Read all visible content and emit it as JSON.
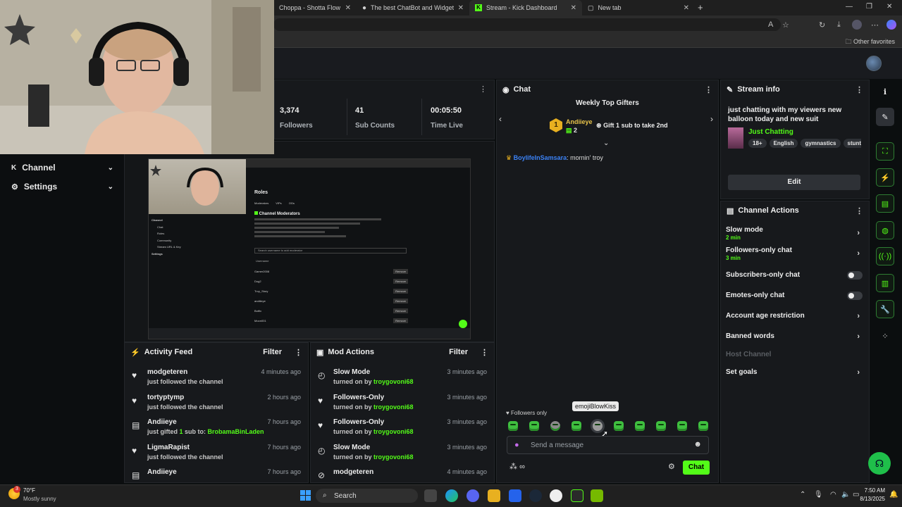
{
  "browser": {
    "tabs": [
      {
        "label": "Choppa - Shotta Flow Remix"
      },
      {
        "label": "The best ChatBot and Widgets fo"
      },
      {
        "label": "Stream - Kick Dashboard"
      },
      {
        "label": "New tab"
      }
    ],
    "other_favorites": "Other favorites"
  },
  "nav": {
    "items": [
      {
        "label": "Channel"
      },
      {
        "label": "Settings"
      }
    ]
  },
  "stats": {
    "followers_value": "3,374",
    "followers_label": "Followers",
    "subs_value": "41",
    "subs_label": "Sub Counts",
    "time_value": "00:05:50",
    "time_label": "Time Live"
  },
  "preview": {
    "roles_title": "Roles",
    "tabs": [
      "Moderators",
      "VIPs",
      "OGs"
    ],
    "section_title": "Channel Moderators",
    "search_placeholder": "Search username to add moderator",
    "column": "Username",
    "mods": [
      "Gamer2008",
      "Dog2",
      "Troy_Story",
      "andiiieye",
      "Botfix",
      "Moon001"
    ],
    "remove_label": "Remove",
    "menu": [
      "Channel",
      "Chat",
      "Roles",
      "Community",
      "Stream URL & Key",
      "Settings"
    ]
  },
  "activity_feed": {
    "title": "Activity Feed",
    "filter": "Filter",
    "items": [
      {
        "name": "modgeteren",
        "sub": "just followed the channel",
        "time": "4 minutes ago"
      },
      {
        "name": "tortyptymp",
        "sub": "just followed the channel",
        "time": "2 hours ago"
      },
      {
        "name": "Andiieye",
        "sub_prefix": "just gifted ",
        "sub_count": "1",
        "sub_mid": " sub to: ",
        "sub_target": "BrobamaBinLaden",
        "time": "7 hours ago"
      },
      {
        "name": "LigmaRapist",
        "sub": "just followed the channel",
        "time": "7 hours ago"
      },
      {
        "name": "Andiieye",
        "sub": "",
        "time": "7 hours ago"
      }
    ]
  },
  "mod_actions": {
    "title": "Mod Actions",
    "filter": "Filter",
    "items": [
      {
        "name": "Slow Mode",
        "sub_prefix": "turned on by ",
        "user": "troygovoni68",
        "time": "3 minutes ago"
      },
      {
        "name": "Followers-Only",
        "sub_prefix": "turned on by ",
        "user": "troygovoni68",
        "time": "3 minutes ago"
      },
      {
        "name": "Followers-Only",
        "sub_prefix": "turned on by ",
        "user": "troygovoni68",
        "time": "3 minutes ago"
      },
      {
        "name": "Slow Mode",
        "sub_prefix": "turned on by ",
        "user": "troygovoni68",
        "time": "3 minutes ago"
      },
      {
        "name": "modgeteren",
        "sub_prefix": "",
        "user": "",
        "time": "4 minutes ago"
      }
    ]
  },
  "chat": {
    "title": "Chat",
    "top_gifters_title": "Weekly Top Gifters",
    "gifter_rank": "1",
    "gifter_name": "Andiieye",
    "gifter_count": "2",
    "gift_cta": "Gift 1 sub to take 2nd",
    "messages": [
      {
        "user": "BoylifeInSamsara",
        "text": ": mornin' troy"
      }
    ],
    "followers_only_label": "Followers only",
    "emote_tooltip": "emojiBlowKiss",
    "input_placeholder": "Send a message",
    "infinity": "∞",
    "send_button": "Chat"
  },
  "stream_info": {
    "title": "Stream info",
    "stream_title": "just chatting with my viewers new balloon today and new suit",
    "category": "Just Chatting",
    "tags": [
      "18+",
      "English",
      "gymnastics",
      "stunt"
    ],
    "edit_button": "Edit"
  },
  "channel_actions": {
    "title": "Channel Actions",
    "rows": [
      {
        "label": "Slow mode",
        "sub": "2 min"
      },
      {
        "label": "Followers-only chat",
        "sub": "3 min"
      },
      {
        "label": "Subscribers-only chat"
      },
      {
        "label": "Emotes-only chat"
      },
      {
        "label": "Account age restriction"
      },
      {
        "label": "Banned words"
      },
      {
        "label": "Host Channel"
      },
      {
        "label": "Set goals"
      }
    ]
  },
  "taskbar": {
    "weather_temp": "70°F",
    "weather_desc": "Mostly sunny",
    "search": "Search",
    "time": "7:50 AM",
    "date": "8/13/2025",
    "notification_count": "3"
  },
  "colors": {
    "kick_green": "#53fc18",
    "panel_bg": "#17191c",
    "page_bg": "#0b0e0f"
  }
}
